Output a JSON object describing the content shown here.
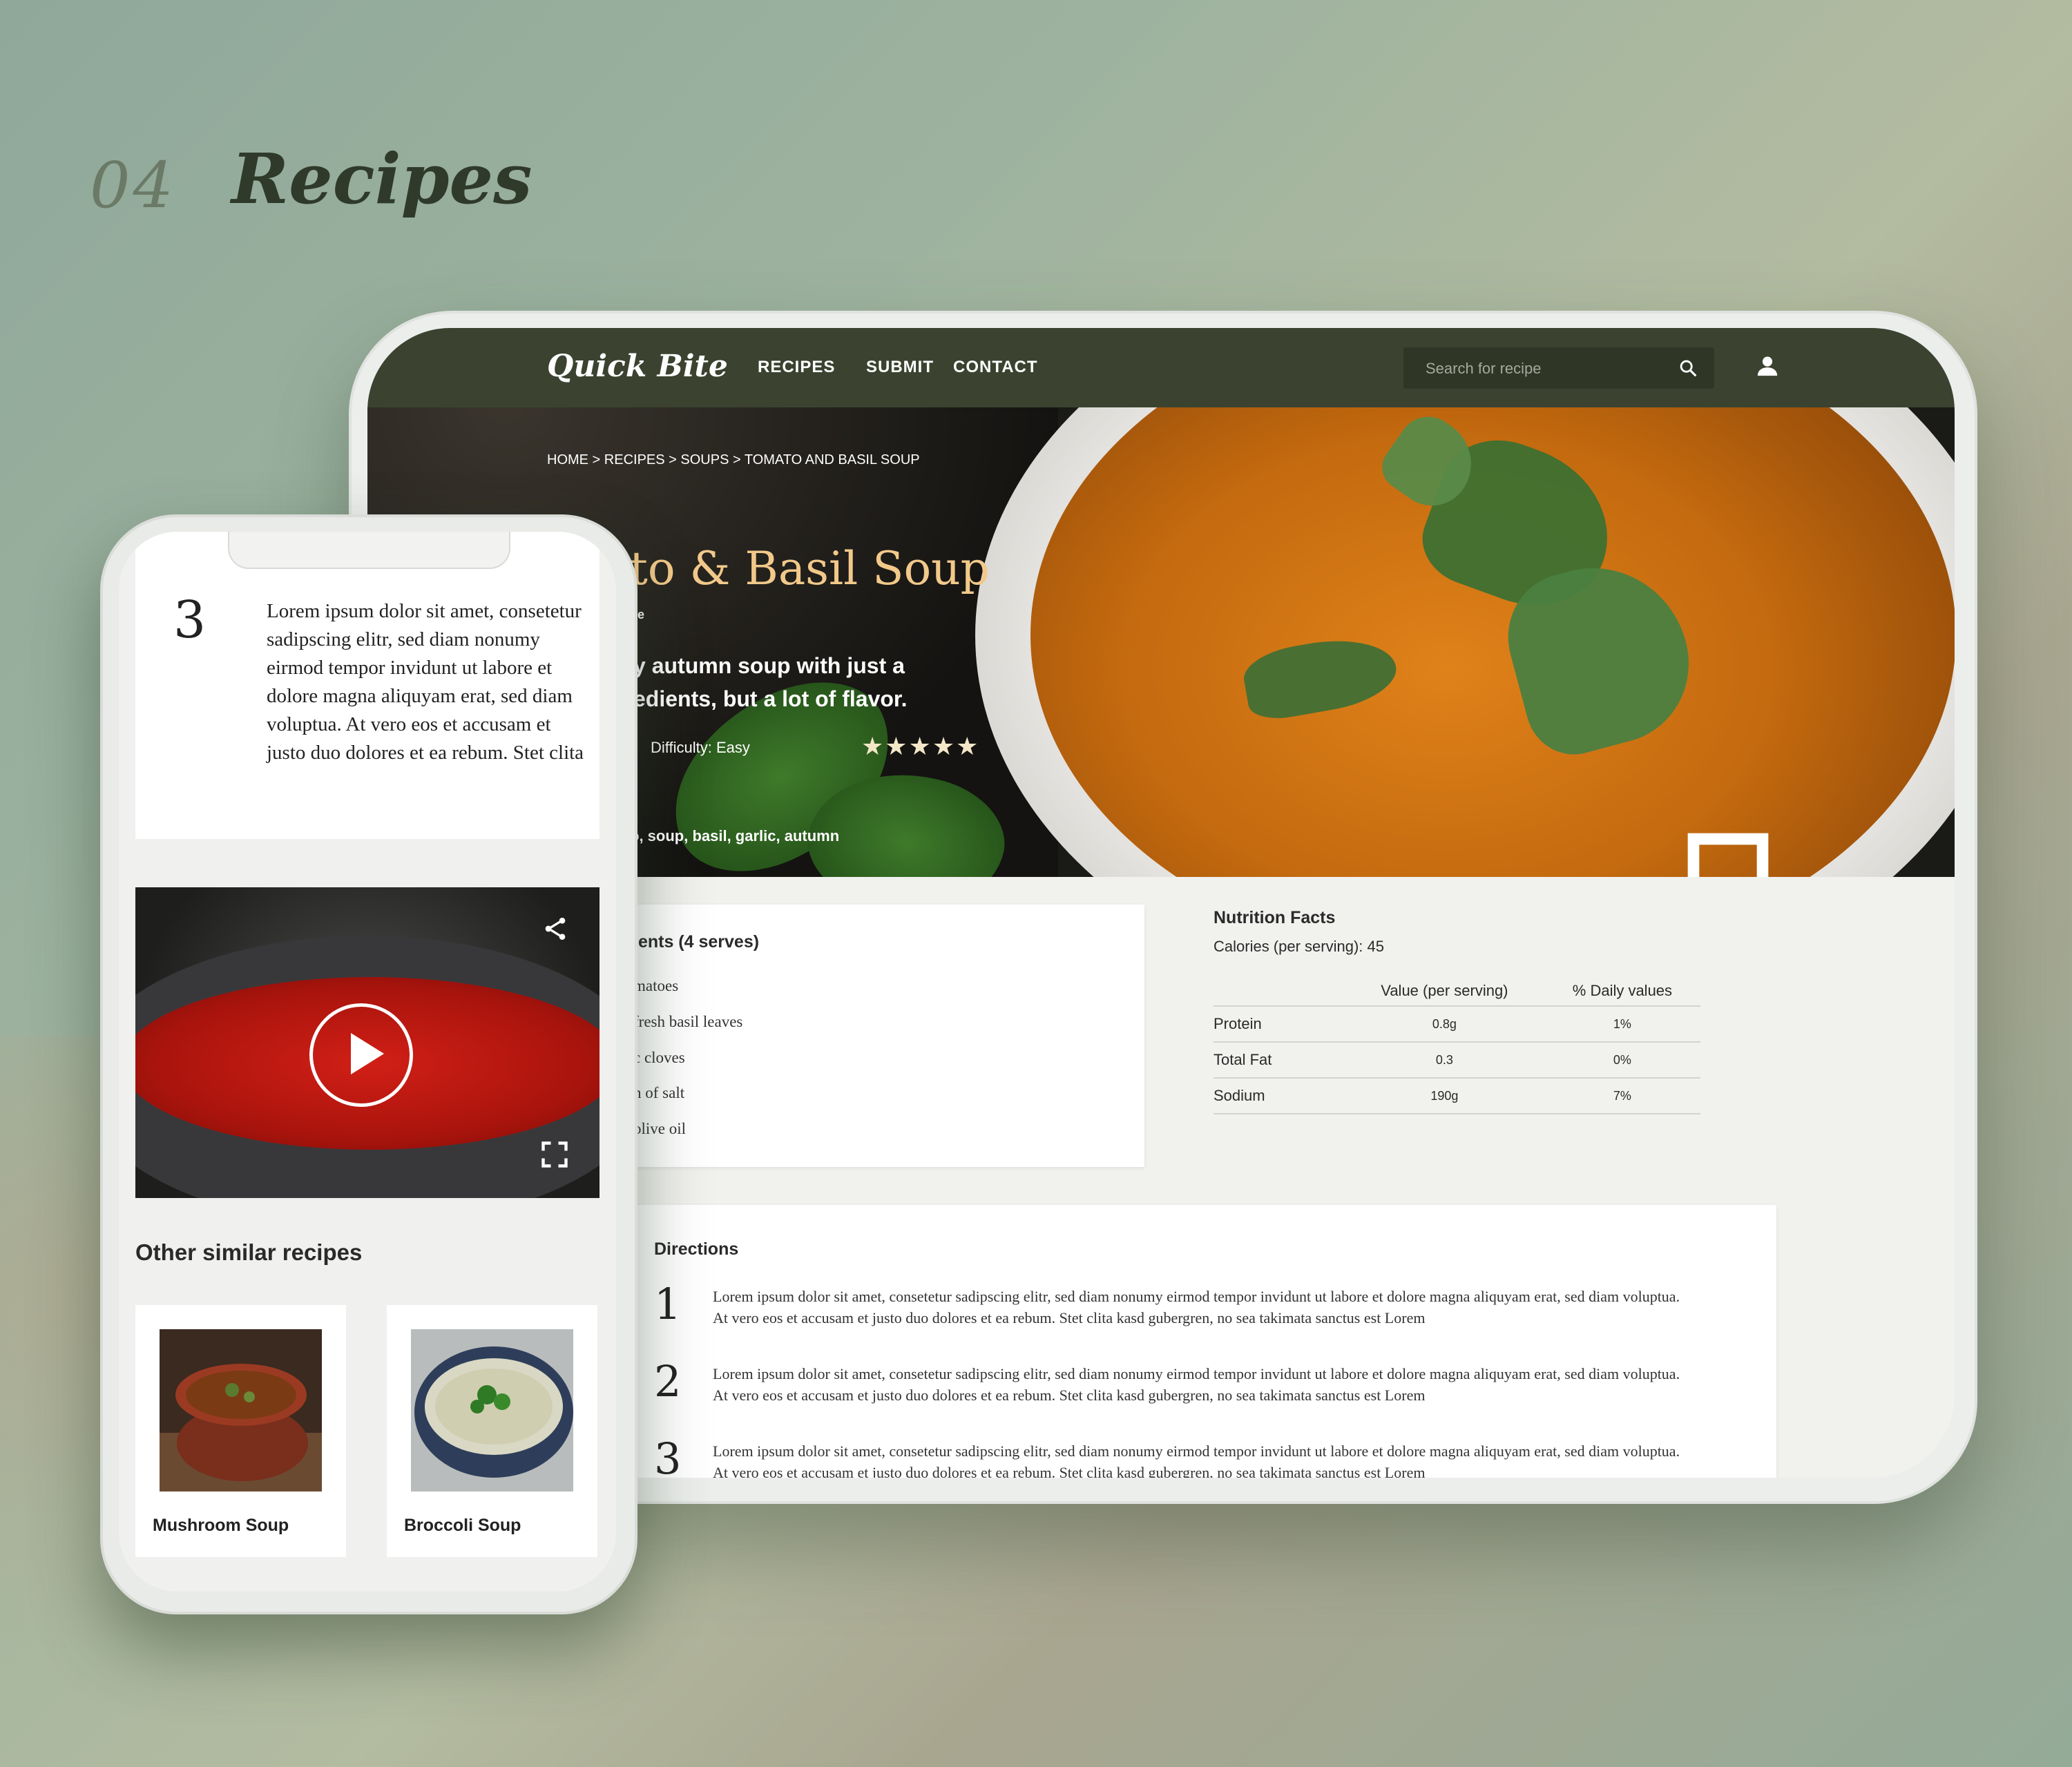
{
  "section": {
    "number": "04",
    "title": "Recipes"
  },
  "desktop": {
    "logo": "Quick Bite",
    "nav": [
      "RECIPES",
      "SUBMIT",
      "CONTACT"
    ],
    "search_placeholder": "Search for recipe",
    "breadcrumb": "HOME > RECIPES > SOUPS > TOMATO AND BASIL SOUP",
    "recipe_title": "ato & Basil Soup",
    "recipe_subtitle": "ne",
    "recipe_desc_line1": "y autumn soup with just a",
    "recipe_desc_line2": "edients, but a lot of flavor.",
    "difficulty": "Difficulty: Easy",
    "rating": 5,
    "stars": "★★★★★",
    "tags": "o, soup, basil, garlic, autumn",
    "ingredients_title": "ients (4 serves)",
    "ingredients": [
      "matoes",
      "fresh basil leaves",
      "c cloves",
      "n of salt",
      "olive oil"
    ],
    "nutrition": {
      "title": "Nutrition Facts",
      "calories": "Calories (per serving): 45",
      "col_value": "Value (per serving)",
      "col_daily": "% Daily values",
      "rows": [
        {
          "name": "Protein",
          "value": "0.8g",
          "daily": "1%"
        },
        {
          "name": "Total Fat",
          "value": "0.3",
          "daily": "0%"
        },
        {
          "name": "Sodium",
          "value": "190g",
          "daily": "7%"
        }
      ]
    },
    "directions_title": "Directions",
    "directions": [
      {
        "num": "1",
        "text": "Lorem ipsum dolor sit amet, consetetur sadipscing elitr, sed diam nonumy eirmod tempor invidunt ut labore et dolore magna aliquyam erat, sed diam voluptua. At vero eos et accusam et justo duo dolores et ea rebum. Stet clita kasd gubergren, no sea takimata sanctus est Lorem"
      },
      {
        "num": "2",
        "text": "Lorem ipsum dolor sit amet, consetetur sadipscing elitr, sed diam nonumy eirmod tempor invidunt ut labore et dolore magna aliquyam erat, sed diam voluptua. At vero eos et accusam et justo duo dolores et ea rebum. Stet clita kasd gubergren, no sea takimata sanctus est Lorem"
      },
      {
        "num": "3",
        "text": "Lorem ipsum dolor sit amet, consetetur sadipscing elitr, sed diam nonumy eirmod tempor invidunt ut labore et dolore magna aliquyam erat, sed diam voluptua. At vero eos et accusam et justo duo dolores et ea rebum. Stet clita kasd gubergren, no sea takimata sanctus est Lorem"
      }
    ]
  },
  "mobile": {
    "step_top_fragment": "clita",
    "step_num": "3",
    "step_text": "Lorem ipsum dolor sit amet, consetetur sadipscing elitr, sed diam nonumy eirmod tempor invidunt ut labore et dolore magna aliquyam erat, sed diam voluptua. At vero eos et accusam et justo duo dolores et ea rebum. Stet clita",
    "similar_title": "Other similar recipes",
    "similar": [
      {
        "name": "Mushroom Soup"
      },
      {
        "name": "Broccoli Soup"
      }
    ]
  },
  "colors": {
    "nav_bg": "#3b4330",
    "title_gold": "#f2c98a",
    "soup_orange": "#d9781a"
  },
  "icons": [
    "search-icon",
    "user-icon",
    "bookmark-icon",
    "share-icon",
    "download-icon",
    "play-icon",
    "fullscreen-icon"
  ]
}
